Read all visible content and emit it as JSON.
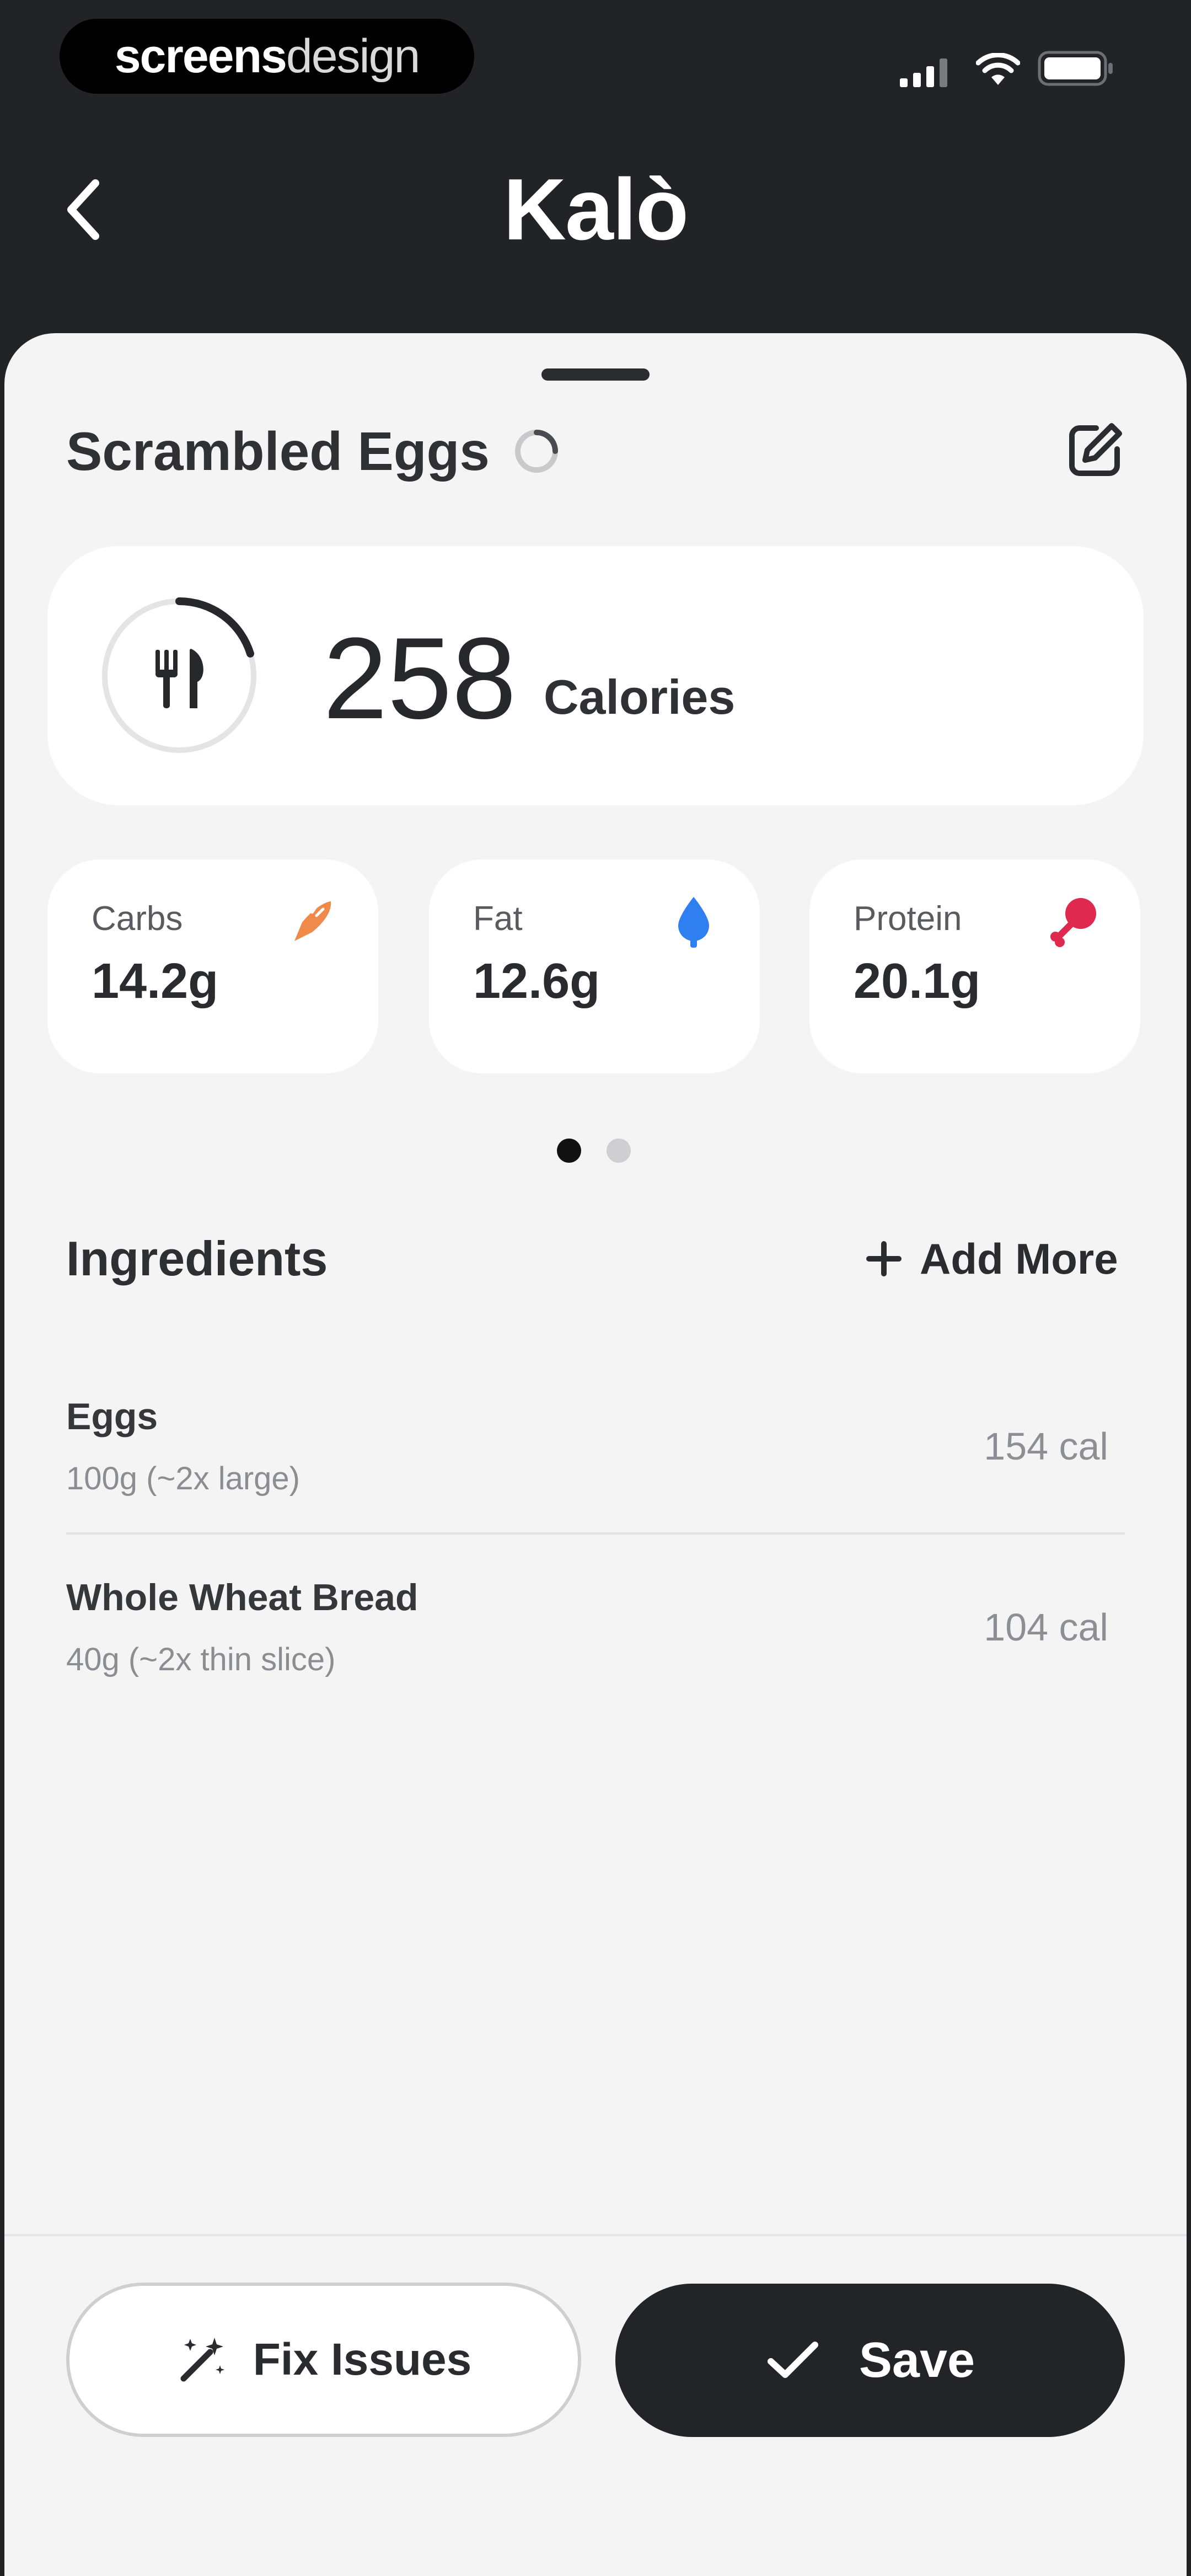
{
  "status_bar": {
    "watermark_bold": "screens",
    "watermark_light": "design"
  },
  "header": {
    "title": "Kalò"
  },
  "meal": {
    "title": "Scrambled Eggs",
    "calories_value": "258",
    "calories_unit": "Calories"
  },
  "macros": [
    {
      "label": "Carbs",
      "value": "14.2g",
      "color": "#f08a4b",
      "icon": "carrot-icon"
    },
    {
      "label": "Fat",
      "value": "12.6g",
      "color": "#2f7ff0",
      "icon": "drop-icon"
    },
    {
      "label": "Protein",
      "value": "20.1g",
      "color": "#e0294f",
      "icon": "drumstick-icon"
    }
  ],
  "pager": {
    "current": 1,
    "total": 2
  },
  "ingredients": {
    "title": "Ingredients",
    "add_label": "Add More",
    "items": [
      {
        "name": "Eggs",
        "detail": "100g (~2x large)",
        "calories": "154 cal"
      },
      {
        "name": "Whole Wheat Bread",
        "detail": "40g (~2x thin slice)",
        "calories": "104 cal"
      }
    ]
  },
  "actions": {
    "fix_label": "Fix Issues",
    "save_label": "Save"
  }
}
